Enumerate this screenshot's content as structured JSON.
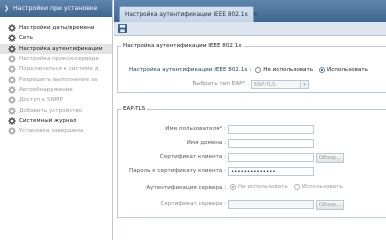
{
  "sidebar": {
    "title": "Настройки при установке",
    "items": [
      {
        "label": "Настройки даты/времени",
        "state": "normal"
      },
      {
        "label": "Сеть",
        "state": "normal"
      },
      {
        "label": "Настройка аутентификации",
        "state": "selected"
      },
      {
        "label": "Настройка прокси-сервера",
        "state": "disabled"
      },
      {
        "label": "Подключаться к системе д",
        "state": "disabled"
      },
      {
        "label": "Разрешить выполнение за",
        "state": "disabled"
      },
      {
        "label": "Автообнаружение",
        "state": "disabled"
      },
      {
        "label": "Доступ к SNMP",
        "state": "disabled"
      },
      {
        "label": "Добавить устройство",
        "state": "disabled"
      },
      {
        "label": "Системный журнал",
        "state": "normal"
      },
      {
        "label": "Установка завершена",
        "state": "disabled"
      }
    ]
  },
  "tab": {
    "label": "Настройка аутентификации IEEE 802.1x",
    "close": "×"
  },
  "section1": {
    "legend": "Настройка аутентификации IEEE 802.1x",
    "auth_label": "Настройка аутентификации IEEE 802.1x :",
    "radio_off": "Не использовать",
    "radio_on": "Использовать",
    "eap_type_label": "Выбрать тип EAP* :",
    "eap_type_value": "EAP-TLS"
  },
  "section2": {
    "legend": "EAP-TLS",
    "username_label": "Имя пользователя* :",
    "username_value": "",
    "domain_label": "Имя домена :",
    "domain_value": "",
    "client_cert_label": "Сертификат клиента :",
    "client_cert_value": "",
    "browse_label": "Обзор...",
    "cert_password_label": "Пароль к сертификату клиента :",
    "cert_password_value": "••••••••••••••",
    "server_auth_label": "Аутентификация сервера :",
    "server_radio_off": "Не использовать",
    "server_radio_on": "Использовать",
    "server_cert_label": "Сертификат сервера :",
    "server_cert_value": "",
    "browse_label2": "Обзор..."
  },
  "colors": {
    "header": "#4a7299",
    "accent": "#1e3f66"
  }
}
